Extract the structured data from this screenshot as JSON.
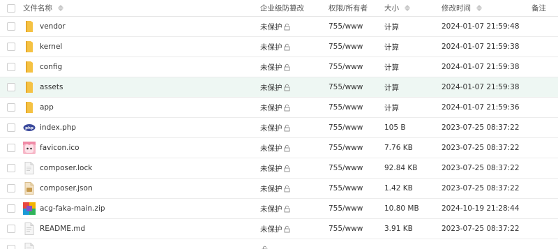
{
  "header": {
    "name": "文件名称",
    "protection": "企业级防篡改",
    "permission": "权限/所有者",
    "size": "大小",
    "modified": "修改时间",
    "note": "备注"
  },
  "files": [
    {
      "name": "vendor",
      "icon": "folder-icon",
      "protection": "未保护",
      "permission": "755/www",
      "size": "计算",
      "modified": "2024-01-07 21:59:48"
    },
    {
      "name": "kernel",
      "icon": "folder-icon",
      "protection": "未保护",
      "permission": "755/www",
      "size": "计算",
      "modified": "2024-01-07 21:59:38"
    },
    {
      "name": "config",
      "icon": "folder-icon",
      "protection": "未保护",
      "permission": "755/www",
      "size": "计算",
      "modified": "2024-01-07 21:59:38"
    },
    {
      "name": "assets",
      "icon": "folder-icon",
      "protection": "未保护",
      "permission": "755/www",
      "size": "计算",
      "modified": "2024-01-07 21:59:38"
    },
    {
      "name": "app",
      "icon": "folder-icon",
      "protection": "未保护",
      "permission": "755/www",
      "size": "计算",
      "modified": "2024-01-07 21:59:36"
    },
    {
      "name": "index.php",
      "icon": "php-file-icon",
      "protection": "未保护",
      "permission": "755/www",
      "size": "105 B",
      "modified": "2023-07-25 08:37:22"
    },
    {
      "name": "favicon.ico",
      "icon": "ico-image-icon",
      "protection": "未保护",
      "permission": "755/www",
      "size": "7.76 KB",
      "modified": "2023-07-25 08:37:22"
    },
    {
      "name": "composer.lock",
      "icon": "document-file-icon",
      "protection": "未保护",
      "permission": "755/www",
      "size": "92.84 KB",
      "modified": "2023-07-25 08:37:22"
    },
    {
      "name": "composer.json",
      "icon": "json-file-icon",
      "protection": "未保护",
      "permission": "755/www",
      "size": "1.42 KB",
      "modified": "2023-07-25 08:37:22"
    },
    {
      "name": "acg-faka-main.zip",
      "icon": "zip-archive-icon",
      "protection": "未保护",
      "permission": "755/www",
      "size": "10.80 MB",
      "modified": "2024-10-19 21:28:44"
    },
    {
      "name": "README.md",
      "icon": "document-file-icon",
      "protection": "未保护",
      "permission": "755/www",
      "size": "3.91 KB",
      "modified": "2023-07-25 08:37:22"
    },
    {
      "name": "",
      "icon": "document-file-icon",
      "protection": "",
      "permission": "",
      "size": "",
      "modified": ""
    }
  ],
  "colors": {
    "calc": "#20a53a",
    "folder": "#f5c243",
    "highlight_row": "#eef7f3"
  }
}
